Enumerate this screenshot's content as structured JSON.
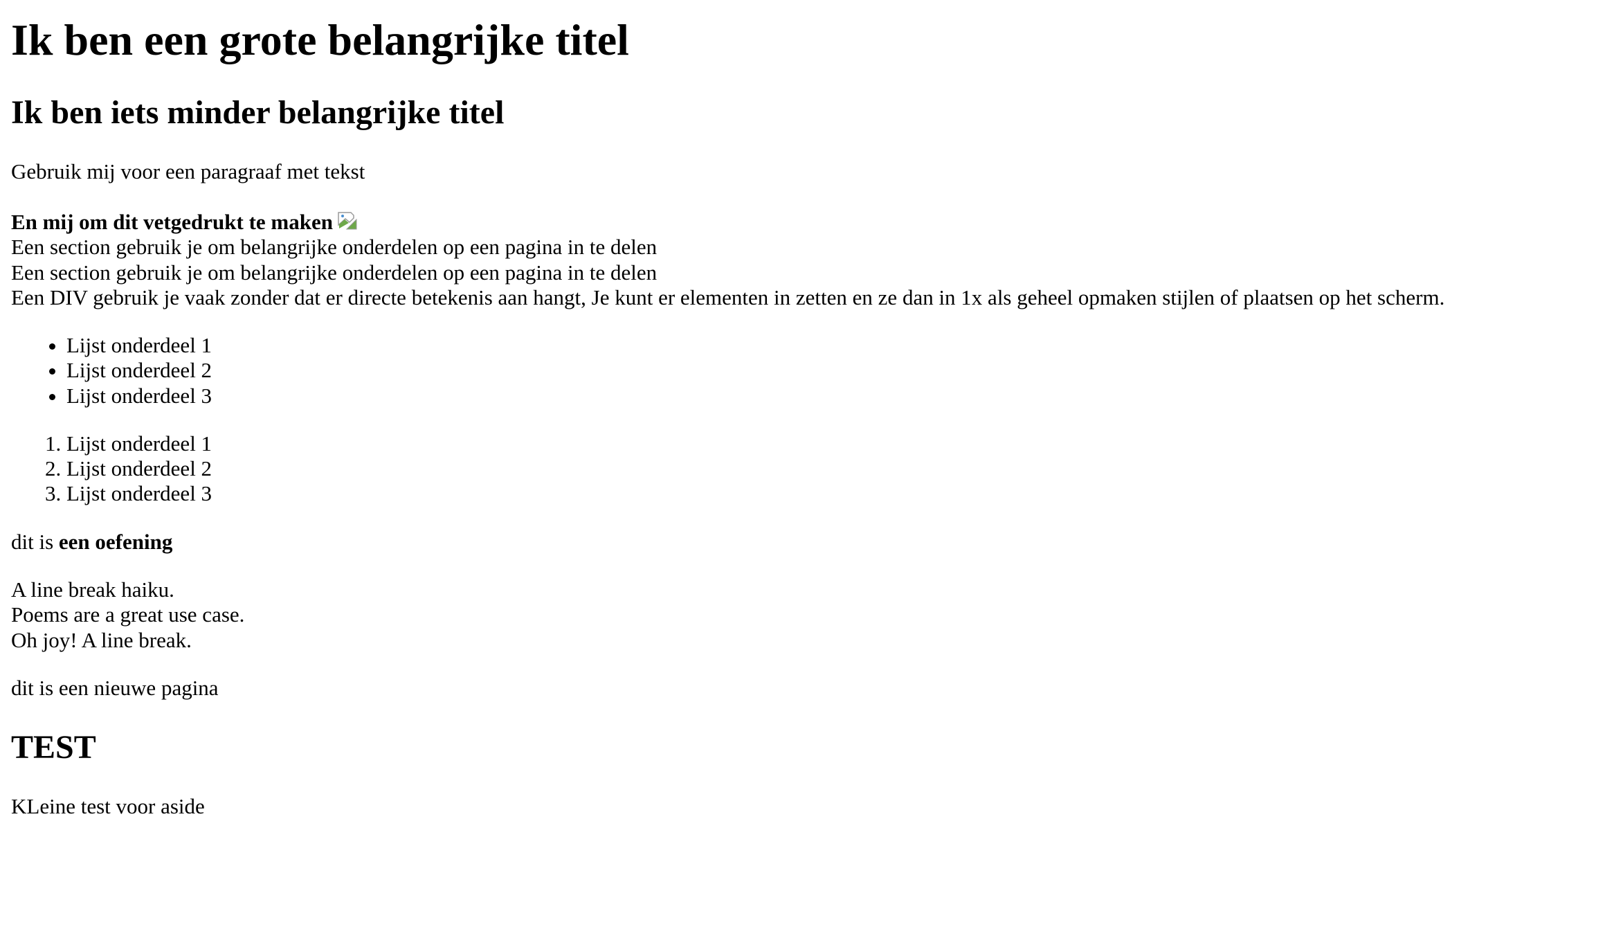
{
  "header": {
    "title": "Ik ben een grote belangrijke titel",
    "subtitle": "Ik ben iets minder belangrijke titel"
  },
  "main": {
    "paragraph": "Gebruik mij voor een paragraaf met tekst",
    "bold_text": "En mij om dit vetgedrukt te maken",
    "image_icon": "broken-image-icon",
    "sections": [
      "Een section gebruik je om belangrijke onderdelen op een pagina in te delen",
      "Een section gebruik je om belangrijke onderdelen op een pagina in te delen"
    ],
    "div_text": "Een DIV gebruik je vaak zonder dat er directe betekenis aan hangt, Je kunt er elementen in zetten en ze dan in 1x als geheel opmaken stijlen of plaatsen op het scherm.",
    "unordered_list": [
      "Lijst onderdeel 1",
      "Lijst onderdeel 2",
      "Lijst onderdeel 3"
    ],
    "ordered_list": [
      "Lijst onderdeel 1",
      "Lijst onderdeel 2",
      "Lijst onderdeel 3"
    ],
    "exercise": {
      "prefix": "dit is ",
      "strong": "een oefening"
    },
    "poem": [
      "A line break haiku.",
      "Poems are a great use case.",
      "Oh joy! A line break."
    ],
    "new_page": "dit is een nieuwe pagina"
  },
  "aside": {
    "title": "TEST",
    "text": "KLeine test voor aside"
  }
}
